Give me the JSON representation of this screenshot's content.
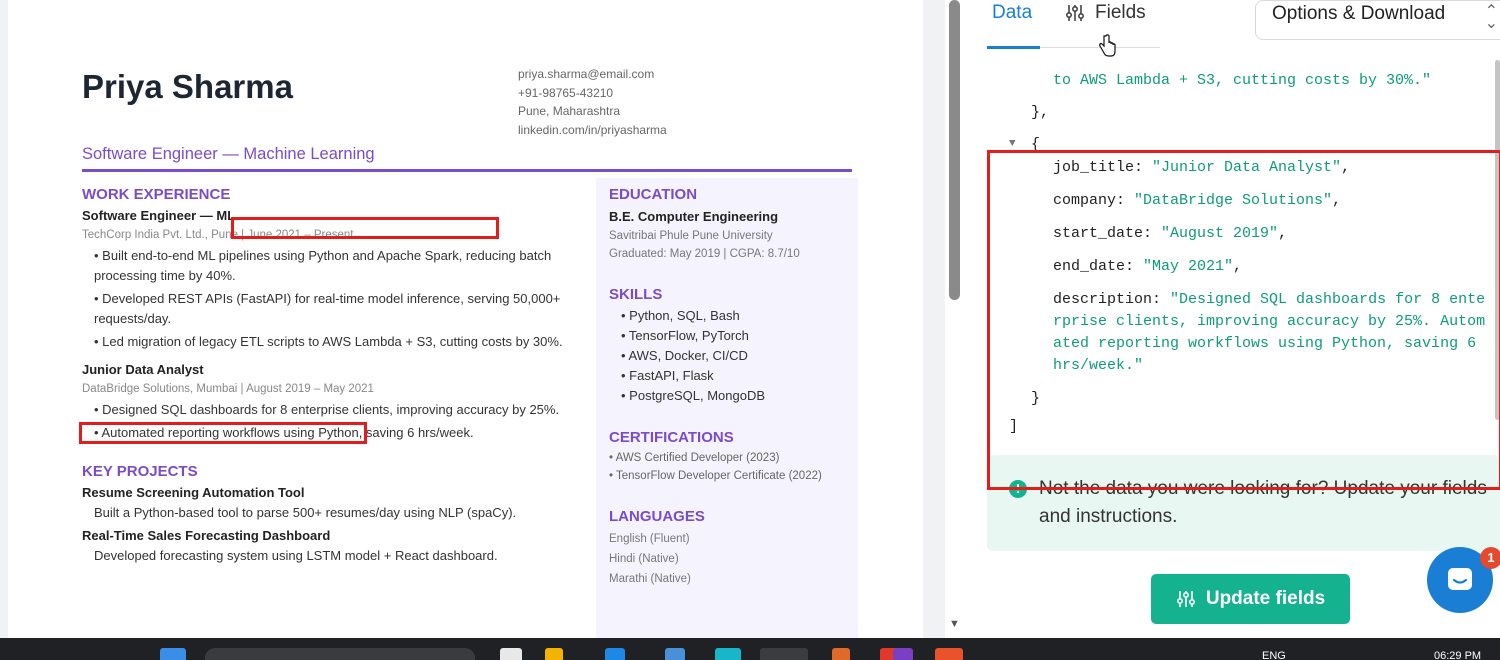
{
  "resume": {
    "name": "Priya Sharma",
    "contact": {
      "email": "priya.sharma@email.com",
      "phone": "+91-98765-43210",
      "location": "Pune, Maharashtra",
      "linkedin": "linkedin.com/in/priyasharma"
    },
    "role": "Software Engineer — Machine Learning",
    "work_title": "WORK EXPERIENCE",
    "jobs": [
      {
        "title": "Software Engineer — ML",
        "meta": "TechCorp India Pvt. Ltd., Pune | June 2021 – Present",
        "bullets": [
          "• Built end-to-end ML pipelines using Python and Apache Spark, reducing batch processing time by 40%.",
          "• Developed REST APIs (FastAPI) for real-time model inference, serving 50,000+ requests/day.",
          "• Led migration of legacy ETL scripts to AWS Lambda + S3, cutting costs by 30%."
        ]
      },
      {
        "title": "Junior Data Analyst",
        "meta": "DataBridge Solutions, Mumbai | August 2019 – May 2021",
        "bullets": [
          "• Designed SQL dashboards for 8 enterprise clients, improving accuracy by 25%.",
          "• Automated reporting workflows using Python, saving 6 hrs/week."
        ]
      }
    ],
    "projects_title": "KEY PROJECTS",
    "projects": [
      {
        "title": "Resume Screening Automation Tool",
        "desc": "Built a Python-based tool to parse 500+ resumes/day using NLP (spaCy)."
      },
      {
        "title": "Real-Time Sales Forecasting Dashboard",
        "desc": "Developed forecasting system using LSTM model + React dashboard."
      }
    ],
    "education": {
      "title": "EDUCATION",
      "degree": "B.E. Computer Engineering",
      "school": "Savitribai Phule Pune University",
      "graduated": "Graduated: May 2019 | CGPA: 8.7/10"
    },
    "skills": {
      "title": "SKILLS",
      "items": [
        "• Python, SQL, Bash",
        "• TensorFlow, PyTorch",
        "• AWS, Docker, CI/CD",
        "• FastAPI, Flask",
        "• PostgreSQL, MongoDB"
      ]
    },
    "certifications": {
      "title": "CERTIFICATIONS",
      "items": [
        "• AWS Certified Developer (2023)",
        "• TensorFlow Developer Certificate (2022)"
      ]
    },
    "languages": {
      "title": "LANGUAGES",
      "items": [
        "English (Fluent)",
        "Hindi (Native)",
        "Marathi (Native)"
      ]
    }
  },
  "panel": {
    "tab_data": "Data",
    "tab_fields": "Fields",
    "options_label": "Options & Download",
    "code_lines": {
      "l1": "to AWS Lambda + S3, cutting costs by 30%.\"",
      "l2": "},",
      "l3": "{",
      "k_job": "job_title: ",
      "v_job": "\"Junior Data Analyst\"",
      "k_company": "company: ",
      "v_company": "\"DataBridge Solutions\"",
      "k_start": "start_date: ",
      "v_start": "\"August 2019\"",
      "k_end": "end_date: ",
      "v_end": "\"May 2021\"",
      "k_desc": "description: ",
      "v_desc1": "\"Designed SQL dashboards for 8 ente",
      "v_desc2": "rprise clients, improving accuracy by 25%. Autom",
      "v_desc3": "ated reporting workflows using Python, saving 6",
      "v_desc4": "hrs/week.\"",
      "l_close": "}",
      "l_bracket": "]"
    },
    "notice": "Not the data you were looking for? Update your fields and instructions.",
    "update_button": "Update fields",
    "chat_badge": "1"
  },
  "taskbar": {
    "lang": "ENG",
    "time": "06:29 PM"
  },
  "colors": {
    "accent_purple": "#7b4cc9",
    "tab_blue": "#1a7fd4",
    "teal": "#14b28e",
    "highlight_red": "#e41c1c"
  }
}
